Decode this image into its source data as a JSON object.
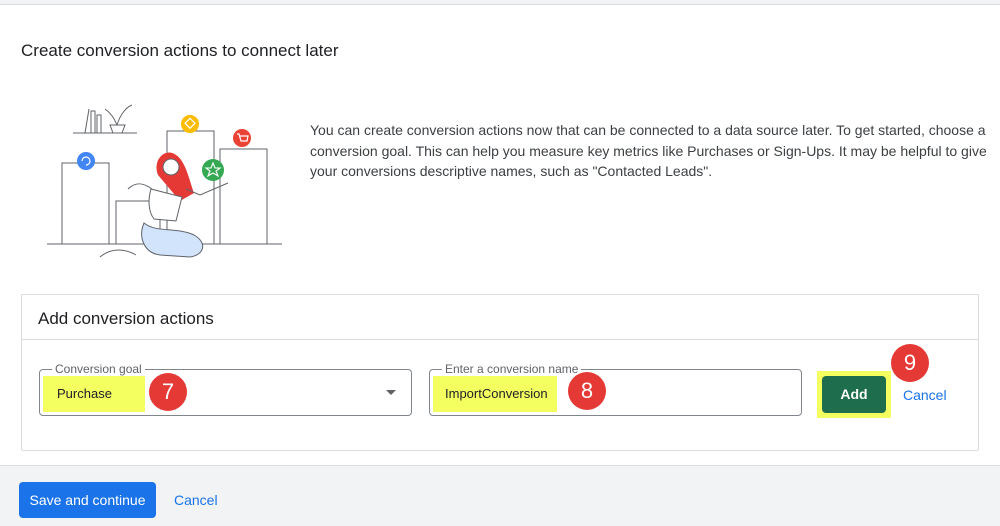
{
  "page": {
    "title": "Create conversion actions to connect later",
    "description": "You can create conversion actions now that can be connected to a data source later. To get started, choose a conversion goal. This can help you measure key metrics like Purchases or Sign-Ups. It may be helpful to give your conversions descriptive names, such as \"Contacted Leads\"."
  },
  "panel": {
    "title": "Add conversion actions",
    "goal_field": {
      "label": "Conversion goal",
      "value": "Purchase",
      "step": "7"
    },
    "name_field": {
      "label": "Enter a conversion name",
      "value": "ImportConversion",
      "step": "8"
    },
    "add_button": {
      "label": "Add",
      "step": "9"
    },
    "cancel_label": "Cancel"
  },
  "footer": {
    "save_label": "Save and continue",
    "cancel_label": "Cancel"
  },
  "colors": {
    "primary_blue": "#1a73e8",
    "add_green": "#1e6e4e",
    "highlight_yellow": "#f4ff60",
    "step_badge_red": "#e53935"
  },
  "icons": [
    "dropdown-arrow-icon",
    "refresh-icon",
    "tag-icon",
    "cart-icon",
    "star-icon"
  ]
}
